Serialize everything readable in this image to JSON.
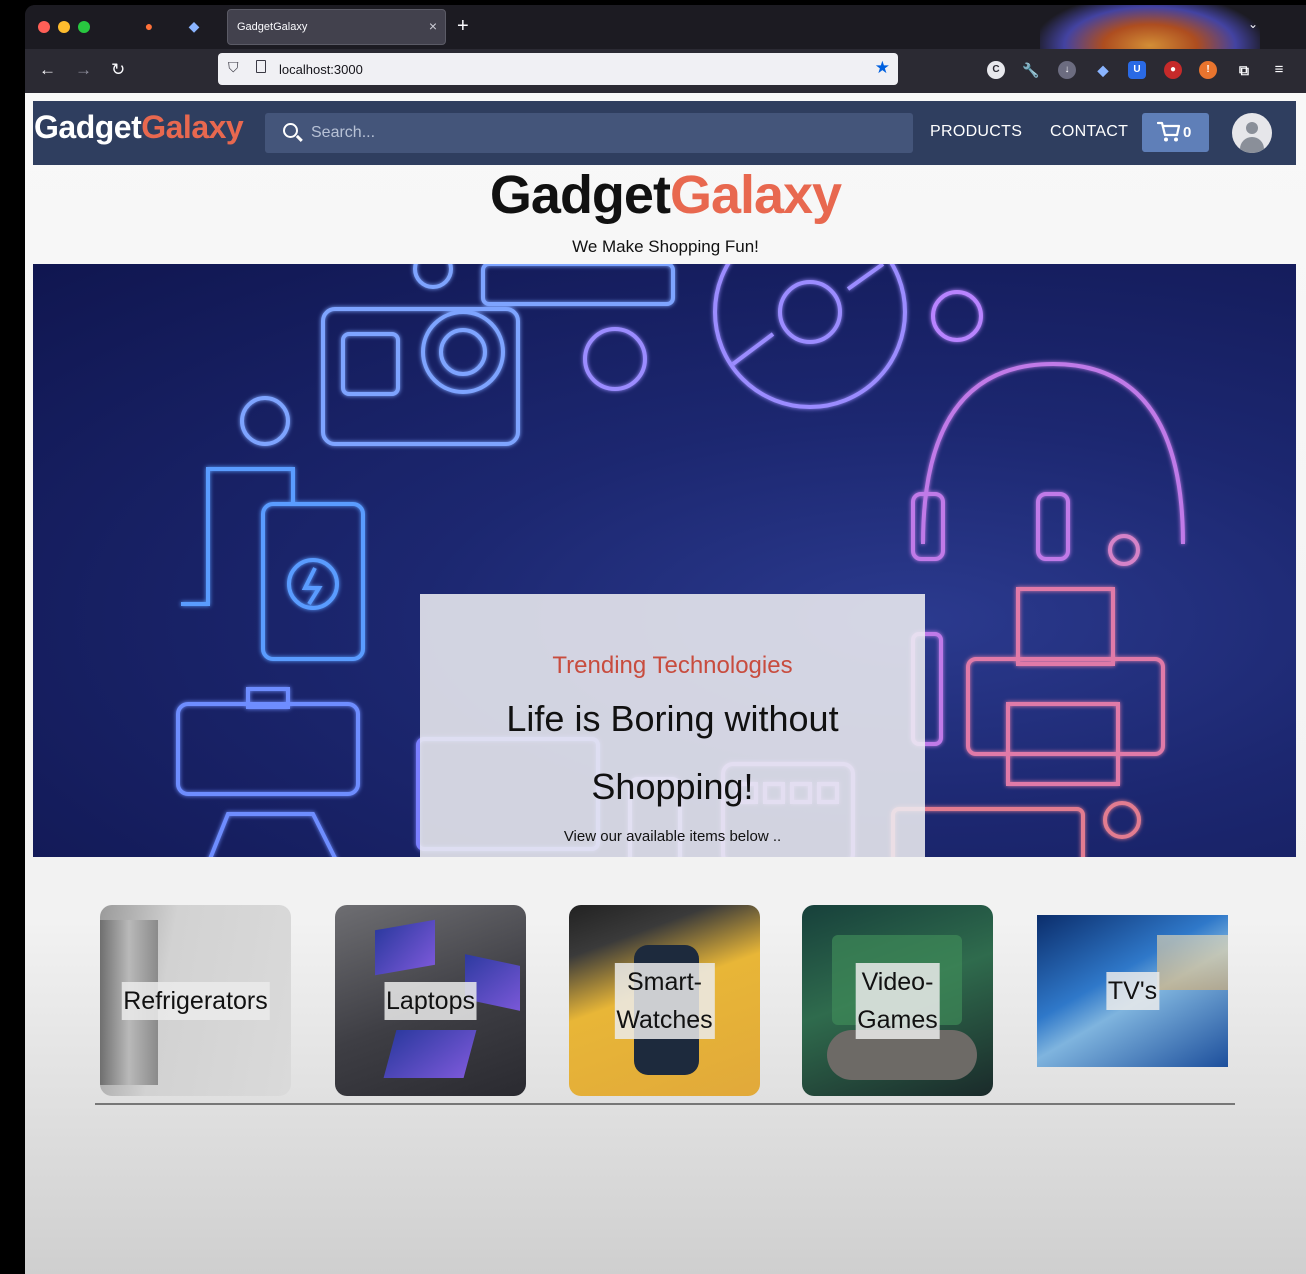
{
  "browser": {
    "tab_title": "GadgetGalaxy",
    "tab_close": "×",
    "new_tab": "+",
    "url": "localhost:3000"
  },
  "navbar": {
    "brand_part1": "Gadget",
    "brand_part2": "Galaxy",
    "search_placeholder": "Search...",
    "products_label": "PRODUCTS",
    "contact_label": "CONTACT",
    "cart_count": "0"
  },
  "hero": {
    "title_part1": "Gadget",
    "title_part2": "Galaxy",
    "tagline": "We Make Shopping Fun!"
  },
  "promo": {
    "kicker": "Trending Technologies",
    "line1": "Life is Boring without",
    "line2": "Shopping!",
    "sub": "View our available items below .."
  },
  "categories": [
    {
      "label": "Refrigerators"
    },
    {
      "label": "Laptops"
    },
    {
      "label": "Smart-\nWatches",
      "line1": "Smart-",
      "line2": "Watches"
    },
    {
      "label": "Video-\nGames",
      "line1": "Video-",
      "line2": "Games"
    },
    {
      "label": "TV's"
    }
  ],
  "colors": {
    "nav_bg": "#2f3e5f",
    "accent": "#e8684f",
    "cart_bg": "#5f7fb8",
    "banner_bg": "#1c2770"
  },
  "icons": [
    "search-icon",
    "cart-icon",
    "user-avatar-icon",
    "back-icon",
    "forward-icon",
    "reload-icon",
    "bookmark-star-icon",
    "shield-icon"
  ]
}
